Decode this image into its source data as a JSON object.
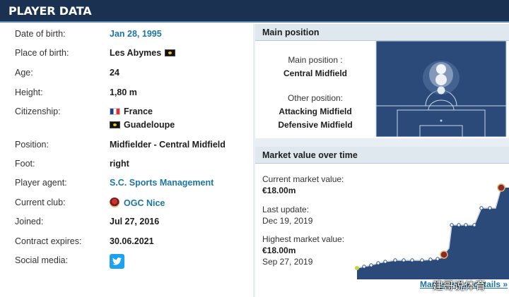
{
  "header": {
    "title": "PLAYER DATA"
  },
  "info": {
    "rows": [
      {
        "label": "Date of birth:",
        "value": "Jan 28, 1995"
      },
      {
        "label": "Place of birth:",
        "value": "Les Abymes"
      },
      {
        "label": "Age:",
        "value": "24"
      },
      {
        "label": "Height:",
        "value": "1,80 m"
      },
      {
        "label": "Citizenship:",
        "value": "France",
        "value2": "Guadeloupe"
      },
      {
        "label": "Position:",
        "value": "Midfielder - Central Midfield"
      },
      {
        "label": "Foot:",
        "value": "right"
      },
      {
        "label": "Player agent:",
        "value": "S.C. Sports Management"
      },
      {
        "label": "Current club:",
        "value": "OGC Nice"
      },
      {
        "label": "Joined:",
        "value": "Jul 27, 2016"
      },
      {
        "label": "Contract expires:",
        "value": "30.06.2021"
      },
      {
        "label": "Social media:",
        "value": ""
      }
    ],
    "social_icon": "twitter-icon"
  },
  "position_panel": {
    "title": "Main position",
    "main_label": "Main position :",
    "main_value": "Central Midfield",
    "other_label": "Other position:",
    "other_values": [
      "Attacking Midfield",
      "Defensive Midfield"
    ],
    "pitch_color": "#2b4a7a"
  },
  "market_panel": {
    "title": "Market value over time",
    "current_label": "Current market value:",
    "current_value": "€18.00m",
    "update_label": "Last update:",
    "update_value": "Dec 19, 2019",
    "highest_label": "Highest market value:",
    "highest_value": "€18.00m",
    "highest_date": "Sep 27, 2019",
    "link_text": "Market value details »",
    "chart_color": "#2b4a7a"
  },
  "watermark": "建哥说体育"
}
